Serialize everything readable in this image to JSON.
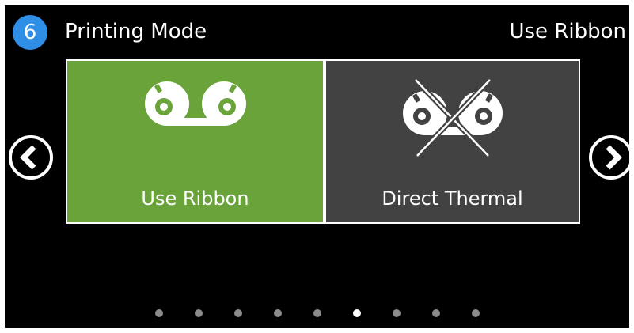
{
  "header": {
    "step_number": "6",
    "title": "Printing Mode",
    "current_value": "Use Ribbon"
  },
  "options": [
    {
      "label": "Use Ribbon",
      "icon": "ribbon-reels-icon",
      "selected": true,
      "color": "#6aa33a"
    },
    {
      "label": "Direct Thermal",
      "icon": "ribbon-reels-crossed-icon",
      "selected": false,
      "color": "#424242"
    }
  ],
  "navigation": {
    "prev_icon": "chevron-left-circle-icon",
    "next_icon": "chevron-right-circle-icon"
  },
  "pagination": {
    "total_pages": 9,
    "current_page": 6
  },
  "colors": {
    "badge": "#2f8fe6",
    "selected_option": "#6aa33a",
    "unselected_option": "#424242",
    "background": "#000000"
  }
}
